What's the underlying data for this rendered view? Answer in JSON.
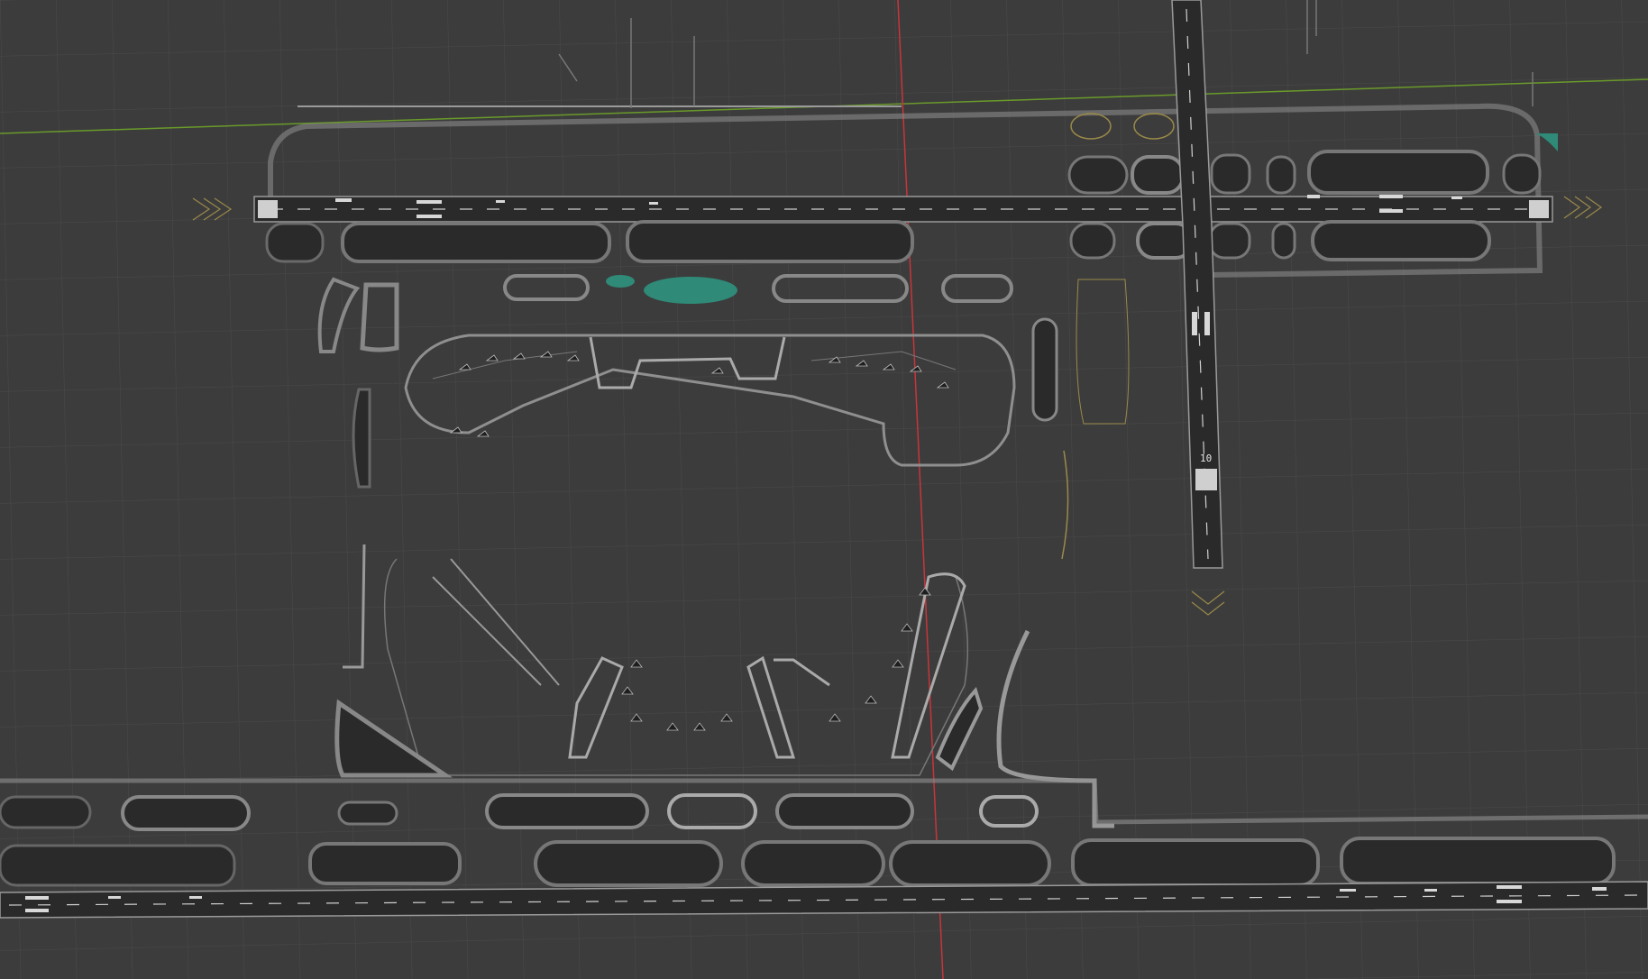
{
  "viewport": {
    "view": "top",
    "background_color": "#3c3c3c",
    "grid_color": "#4a4a4a",
    "x_axis_color": "#c8353b",
    "y_axis_color": "#6a9a2a"
  },
  "scene": {
    "object": "airport layout",
    "runways": [
      {
        "id": "rwy-north",
        "orientation": "horizontal"
      },
      {
        "id": "rwy-south",
        "orientation": "horizontal"
      },
      {
        "id": "rwy-cross",
        "orientation": "vertical",
        "marking": "10"
      }
    ],
    "colors": {
      "pavement_dark": "#2a2a2a",
      "pavement_edge": "#8f8f8f",
      "taxi_line": "#9a8a4a",
      "grass_island": "#3c3c3c",
      "water": "#2f8a78",
      "light_structure": "#bdbdbd"
    }
  }
}
